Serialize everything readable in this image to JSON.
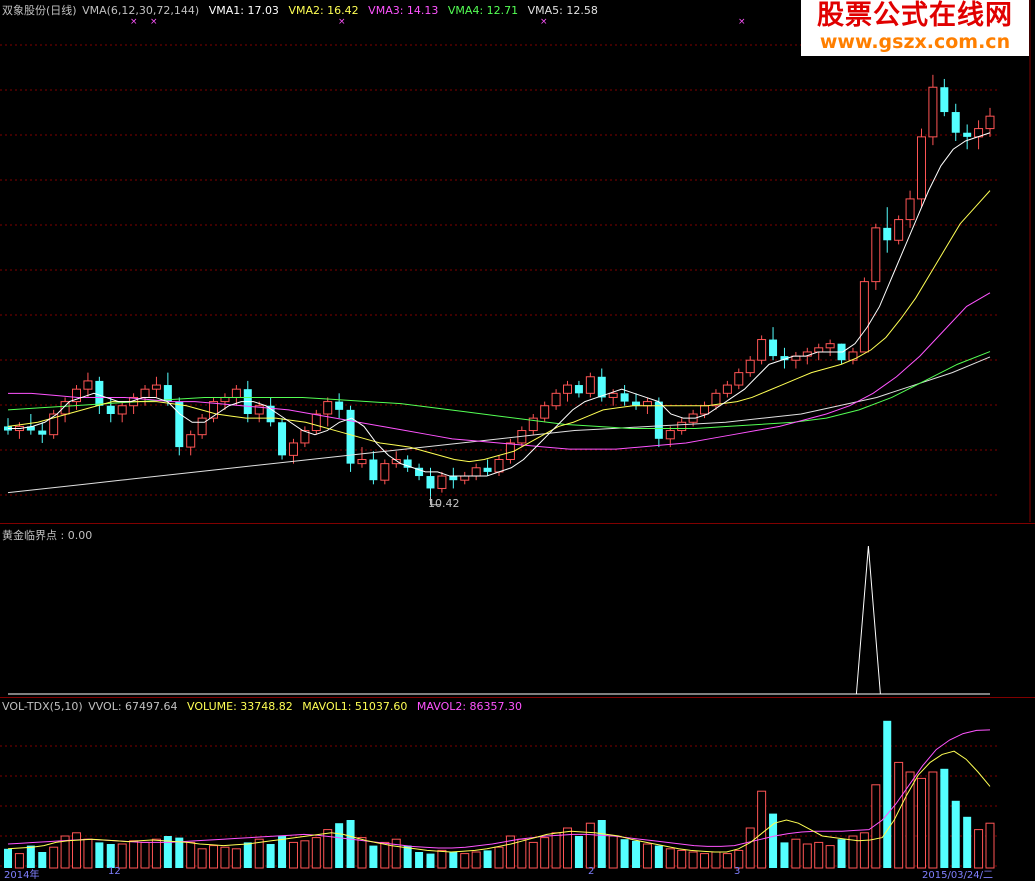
{
  "main_header": {
    "name": "双象股份(日线)",
    "indicator": "VMA(6,12,30,72,144)",
    "vma1": "VMA1: 17.03",
    "vma2": "VMA2: 16.42",
    "vma3": "VMA3: 14.13",
    "vma4": "VMA4: 12.71",
    "vma5": "VMA5: 12.58"
  },
  "watermark": {
    "title": "股票公式在线网",
    "url": "www.gszx.com.cn"
  },
  "low_marker": "10.42",
  "signal_header": {
    "label": "黄金临界点 : 0.00"
  },
  "volume_header": {
    "indicator": "VOL-TDX(5,10)",
    "vvol": "VVOL: 67497.64",
    "volume": "VOLUME: 33748.82",
    "mavol1": "MAVOL1: 51037.60",
    "mavol2": "MAVOL2: 86357.30"
  },
  "x_axis": {
    "start": "2014年",
    "mid1": "12",
    "mid2": "2",
    "mid3": "3",
    "end": "2015/03/24/二"
  },
  "colors": {
    "up": "#ff5555",
    "down": "#54ffff",
    "vma1": "#ffffff",
    "vma2": "#ffff54",
    "vma3": "#ff54ff",
    "vma4": "#54ff54",
    "vma5": "#e0e0e0",
    "grid": "#800000"
  },
  "chart_data": {
    "type": "candlestick",
    "candles": [
      [
        10.9,
        11.1,
        10.7,
        10.8
      ],
      [
        10.8,
        11.0,
        10.6,
        10.9
      ],
      [
        10.9,
        11.2,
        10.7,
        10.8
      ],
      [
        10.8,
        11.0,
        10.5,
        10.7
      ],
      [
        10.7,
        11.3,
        10.6,
        11.2
      ],
      [
        11.2,
        11.6,
        11.0,
        11.5
      ],
      [
        11.5,
        11.9,
        11.3,
        11.8
      ],
      [
        11.8,
        12.2,
        11.6,
        12.0
      ],
      [
        12.0,
        12.1,
        11.2,
        11.4
      ],
      [
        11.4,
        11.6,
        11.0,
        11.2
      ],
      [
        11.2,
        11.5,
        11.0,
        11.4
      ],
      [
        11.4,
        11.7,
        11.2,
        11.6
      ],
      [
        11.6,
        11.9,
        11.4,
        11.8
      ],
      [
        11.8,
        12.1,
        11.6,
        11.9
      ],
      [
        11.9,
        12.2,
        11.4,
        11.5
      ],
      [
        11.5,
        11.6,
        10.2,
        10.4
      ],
      [
        10.4,
        10.8,
        10.2,
        10.7
      ],
      [
        10.7,
        11.2,
        10.6,
        11.1
      ],
      [
        11.1,
        11.6,
        11.0,
        11.5
      ],
      [
        11.5,
        11.7,
        11.3,
        11.6
      ],
      [
        11.6,
        11.9,
        11.4,
        11.8
      ],
      [
        11.8,
        12.0,
        11.0,
        11.2
      ],
      [
        11.2,
        11.5,
        11.0,
        11.4
      ],
      [
        11.4,
        11.6,
        10.9,
        11.0
      ],
      [
        11.0,
        11.1,
        10.1,
        10.2
      ],
      [
        10.2,
        10.6,
        10.0,
        10.5
      ],
      [
        10.5,
        10.9,
        10.4,
        10.8
      ],
      [
        10.8,
        11.3,
        10.7,
        11.2
      ],
      [
        11.2,
        11.6,
        10.9,
        11.5
      ],
      [
        11.5,
        11.7,
        11.1,
        11.3
      ],
      [
        11.3,
        11.4,
        9.8,
        10.0
      ],
      [
        10.0,
        10.4,
        9.9,
        10.1
      ],
      [
        10.1,
        10.3,
        9.5,
        9.6
      ],
      [
        9.6,
        10.1,
        9.5,
        10.0
      ],
      [
        10.0,
        10.3,
        9.9,
        10.1
      ],
      [
        10.1,
        10.2,
        9.8,
        9.9
      ],
      [
        9.9,
        10.0,
        9.6,
        9.7
      ],
      [
        9.7,
        9.9,
        9.2,
        9.4
      ],
      [
        9.4,
        9.8,
        9.3,
        9.7
      ],
      [
        9.7,
        9.9,
        9.4,
        9.6
      ],
      [
        9.6,
        9.8,
        9.5,
        9.7
      ],
      [
        9.7,
        10.0,
        9.6,
        9.9
      ],
      [
        9.9,
        10.1,
        9.7,
        9.8
      ],
      [
        9.8,
        10.2,
        9.7,
        10.1
      ],
      [
        10.1,
        10.6,
        10.0,
        10.5
      ],
      [
        10.5,
        10.9,
        10.4,
        10.8
      ],
      [
        10.8,
        11.2,
        10.7,
        11.1
      ],
      [
        11.1,
        11.5,
        11.0,
        11.4
      ],
      [
        11.4,
        11.8,
        11.3,
        11.7
      ],
      [
        11.7,
        12.0,
        11.5,
        11.9
      ],
      [
        11.9,
        12.0,
        11.6,
        11.7
      ],
      [
        11.7,
        12.2,
        11.6,
        12.1
      ],
      [
        12.1,
        12.3,
        11.5,
        11.6
      ],
      [
        11.6,
        11.8,
        11.4,
        11.7
      ],
      [
        11.7,
        11.9,
        11.4,
        11.5
      ],
      [
        11.5,
        11.7,
        11.3,
        11.4
      ],
      [
        11.4,
        11.6,
        11.2,
        11.5
      ],
      [
        11.5,
        11.6,
        10.4,
        10.6
      ],
      [
        10.6,
        10.9,
        10.4,
        10.8
      ],
      [
        10.8,
        11.1,
        10.7,
        11.0
      ],
      [
        11.0,
        11.3,
        10.9,
        11.2
      ],
      [
        11.2,
        11.5,
        11.1,
        11.4
      ],
      [
        11.4,
        11.8,
        11.3,
        11.7
      ],
      [
        11.7,
        12.0,
        11.6,
        11.9
      ],
      [
        11.9,
        12.3,
        11.8,
        12.2
      ],
      [
        12.2,
        12.6,
        12.1,
        12.5
      ],
      [
        12.5,
        13.1,
        12.4,
        13.0
      ],
      [
        13.0,
        13.3,
        12.5,
        12.6
      ],
      [
        12.6,
        12.8,
        12.3,
        12.5
      ],
      [
        12.5,
        12.7,
        12.3,
        12.6
      ],
      [
        12.6,
        12.8,
        12.4,
        12.7
      ],
      [
        12.7,
        12.9,
        12.5,
        12.8
      ],
      [
        12.8,
        13.0,
        12.6,
        12.9
      ],
      [
        12.9,
        12.9,
        12.4,
        12.5
      ],
      [
        12.5,
        12.8,
        12.4,
        12.7
      ],
      [
        12.7,
        14.5,
        12.7,
        14.4
      ],
      [
        14.4,
        15.8,
        14.2,
        15.7
      ],
      [
        15.7,
        16.2,
        15.1,
        15.4
      ],
      [
        15.4,
        16.0,
        15.3,
        15.9
      ],
      [
        15.9,
        16.6,
        15.7,
        16.4
      ],
      [
        16.4,
        18.1,
        16.2,
        17.9
      ],
      [
        17.9,
        19.4,
        17.7,
        19.1
      ],
      [
        19.1,
        19.3,
        18.4,
        18.5
      ],
      [
        18.5,
        18.7,
        17.8,
        18.0
      ],
      [
        18.0,
        18.2,
        17.6,
        17.9
      ],
      [
        17.9,
        18.3,
        17.6,
        18.1
      ],
      [
        18.1,
        18.6,
        17.9,
        18.4
      ]
    ],
    "vma1_line": [
      10.85,
      10.85,
      10.9,
      11.0,
      11.2,
      11.5,
      11.6,
      11.7,
      11.6,
      11.5,
      11.5,
      11.6,
      11.6,
      11.5,
      11.2,
      11.0,
      11.0,
      11.2,
      11.4,
      11.5,
      11.5,
      11.4,
      11.2,
      11.0,
      10.8,
      10.7,
      10.8,
      11.0,
      11.1,
      10.9,
      10.5,
      10.2,
      10.0,
      9.9,
      9.8,
      9.8,
      9.7,
      9.7,
      9.7,
      9.7,
      9.8,
      9.9,
      10.1,
      10.4,
      10.7,
      11.0,
      11.3,
      11.5,
      11.6,
      11.7,
      11.8,
      11.7,
      11.6,
      11.5,
      11.2,
      11.1,
      11.1,
      11.2,
      11.4,
      11.6,
      11.8,
      12.1,
      12.4,
      12.5,
      12.6,
      12.6,
      12.7,
      12.7,
      12.7,
      12.9,
      13.3,
      13.8,
      14.5,
      15.2,
      15.9,
      16.6,
      17.2,
      17.6,
      17.8,
      17.9,
      18.0
    ],
    "vma2_line": [
      10.9,
      10.95,
      11.0,
      11.1,
      11.2,
      11.3,
      11.4,
      11.5,
      11.5,
      11.5,
      11.5,
      11.45,
      11.4,
      11.3,
      11.2,
      11.15,
      11.1,
      11.1,
      11.1,
      11.05,
      11.0,
      10.9,
      10.8,
      10.7,
      10.6,
      10.5,
      10.45,
      10.4,
      10.3,
      10.2,
      10.1,
      10.05,
      10.1,
      10.2,
      10.3,
      10.5,
      10.7,
      10.9,
      11.0,
      11.15,
      11.3,
      11.35,
      11.4,
      11.4,
      11.4,
      11.4,
      11.4,
      11.4,
      11.45,
      11.5,
      11.6,
      11.75,
      11.9,
      12.05,
      12.2,
      12.3,
      12.4,
      12.55,
      12.75,
      13.05,
      13.5,
      14.0,
      14.6,
      15.2,
      15.8,
      16.2,
      16.6
    ],
    "vma3_line": [
      11.7,
      11.7,
      11.65,
      11.6,
      11.6,
      11.6,
      11.55,
      11.5,
      11.5,
      11.45,
      11.4,
      11.35,
      11.3,
      11.2,
      11.1,
      11.0,
      10.9,
      10.8,
      10.7,
      10.6,
      10.55,
      10.5,
      10.45,
      10.4,
      10.35,
      10.35,
      10.35,
      10.4,
      10.45,
      10.5,
      10.6,
      10.7,
      10.8,
      10.9,
      11.05,
      11.2,
      11.4,
      11.7,
      12.1,
      12.6,
      13.2,
      13.8,
      14.13
    ],
    "vma4_line": [
      11.3,
      11.35,
      11.4,
      11.45,
      11.5,
      11.55,
      11.6,
      11.6,
      11.6,
      11.6,
      11.55,
      11.5,
      11.45,
      11.35,
      11.25,
      11.15,
      11.05,
      10.95,
      10.9,
      10.85,
      10.85,
      10.85,
      10.9,
      10.95,
      11.0,
      11.1,
      11.3,
      11.6,
      12.0,
      12.4,
      12.71
    ],
    "vma5_line": [
      9.3,
      9.4,
      9.5,
      9.6,
      9.7,
      9.8,
      9.9,
      10.0,
      10.1,
      10.2,
      10.3,
      10.4,
      10.5,
      10.6,
      10.7,
      10.8,
      10.85,
      10.9,
      10.95,
      11.0,
      11.1,
      11.2,
      11.4,
      11.6,
      11.9,
      12.2,
      12.58
    ],
    "signal_spike_index": 75,
    "volume": [
      12000,
      9000,
      14000,
      10000,
      13000,
      20000,
      22000,
      18000,
      16000,
      15000,
      15000,
      17000,
      16000,
      18000,
      20000,
      19000,
      16000,
      12000,
      14000,
      13000,
      12000,
      16000,
      18000,
      15000,
      20000,
      16000,
      17000,
      19000,
      24000,
      28000,
      30000,
      19000,
      14000,
      16000,
      18000,
      14000,
      10000,
      9000,
      11000,
      10000,
      9000,
      10000,
      11000,
      13000,
      20000,
      18000,
      16000,
      19000,
      22000,
      25000,
      20000,
      28000,
      30000,
      20000,
      18000,
      17000,
      15000,
      14000,
      12000,
      11000,
      10000,
      9000,
      10000,
      9000,
      11000,
      25000,
      48000,
      34000,
      16000,
      18000,
      15000,
      16000,
      14000,
      18000,
      20000,
      22000,
      52000,
      92000,
      66000,
      60000,
      56000,
      60000,
      62000,
      42000,
      32000,
      24000,
      28000
    ],
    "mavol1_line": [
      12000,
      12500,
      13000,
      14000,
      16000,
      17000,
      17500,
      18000,
      17500,
      17000,
      16500,
      17000,
      17500,
      17000,
      16500,
      16000,
      15000,
      14500,
      14000,
      14500,
      15000,
      16000,
      17000,
      18000,
      19000,
      20000,
      21000,
      22000,
      21000,
      19000,
      17000,
      15500,
      14000,
      13000,
      12000,
      11000,
      10500,
      10000,
      10500,
      11000,
      12000,
      13500,
      15000,
      17000,
      19000,
      21000,
      22000,
      23000,
      22500,
      22000,
      21000,
      20000,
      18000,
      16500,
      15000,
      13500,
      12000,
      11000,
      10500,
      10000,
      10000,
      12000,
      16000,
      22000,
      28000,
      30000,
      28000,
      24000,
      20000,
      19000,
      18000,
      17000,
      17500,
      19000,
      30000,
      45000,
      58000,
      66000,
      71000,
      73000,
      68000,
      60000,
      51000
    ],
    "mavol2_line": [
      15000,
      15500,
      16000,
      16500,
      17000,
      17500,
      18000,
      17500,
      17000,
      16500,
      16000,
      16000,
      16000,
      16500,
      17000,
      17500,
      18000,
      18500,
      19000,
      19500,
      20000,
      20500,
      21000,
      20500,
      19500,
      18500,
      17500,
      16500,
      15500,
      14500,
      13500,
      13000,
      12500,
      12500,
      13000,
      14000,
      15000,
      16500,
      18000,
      19000,
      20000,
      20500,
      21000,
      21000,
      20500,
      20000,
      19000,
      18000,
      17000,
      16000,
      15000,
      14000,
      13500,
      13500,
      14000,
      16000,
      18000,
      20000,
      21500,
      22500,
      23000,
      23000,
      23000,
      23500,
      24000,
      30000,
      40000,
      52000,
      64000,
      74000,
      80000,
      84000,
      86000,
      86357
    ]
  }
}
